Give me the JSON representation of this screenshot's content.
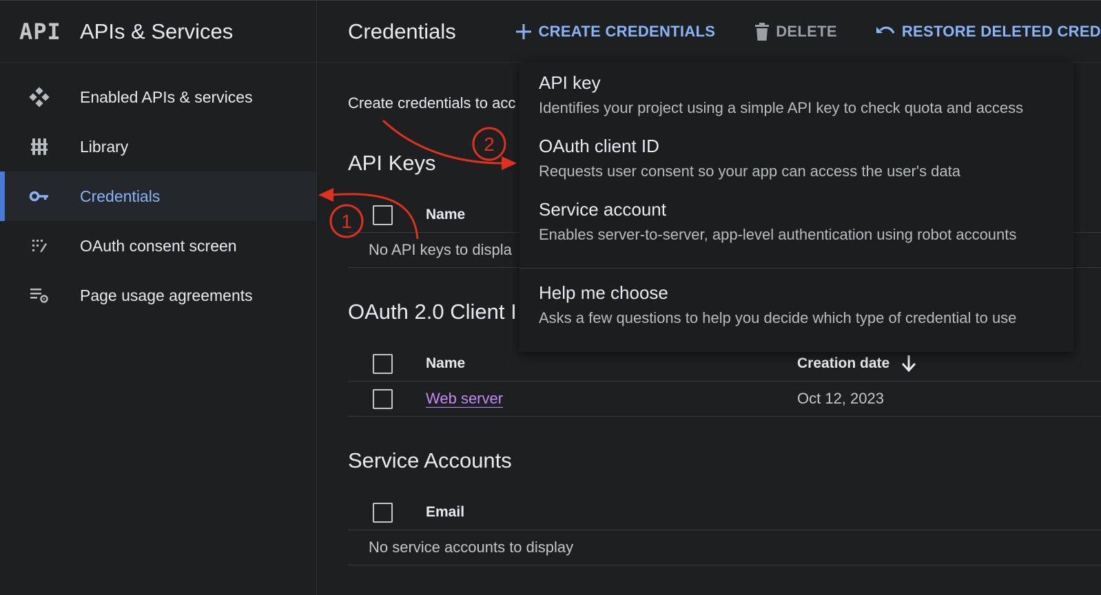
{
  "sidebar": {
    "logo": "API",
    "title": "APIs & Services",
    "items": [
      {
        "label": "Enabled APIs & services",
        "icon": "diamond-grid-icon"
      },
      {
        "label": "Library",
        "icon": "library-icon"
      },
      {
        "label": "Credentials",
        "icon": "key-icon",
        "active": true
      },
      {
        "label": "OAuth consent screen",
        "icon": "consent-screen-icon"
      },
      {
        "label": "Page usage agreements",
        "icon": "settings-list-icon"
      }
    ]
  },
  "toolbar": {
    "title": "Credentials",
    "create_label": "CREATE CREDENTIALS",
    "delete_label": "DELETE",
    "restore_label": "RESTORE DELETED CRED"
  },
  "main": {
    "intro": "Create credentials to acc",
    "api_keys": {
      "title": "API Keys",
      "columns": [
        "Name"
      ],
      "empty": "No API keys to displa"
    },
    "oauth_clients": {
      "title": "OAuth 2.0 Client I",
      "columns": [
        "Name",
        "Creation date"
      ],
      "rows": [
        {
          "name": "Web server",
          "creation_date": "Oct 12, 2023"
        }
      ]
    },
    "service_accounts": {
      "title": "Service Accounts",
      "columns": [
        "Email"
      ],
      "empty": "No service accounts to display"
    }
  },
  "menu": {
    "items": [
      {
        "title": "API key",
        "desc": "Identifies your project using a simple API key to check quota and access"
      },
      {
        "title": "OAuth client ID",
        "desc": "Requests user consent so your app can access the user's data"
      },
      {
        "title": "Service account",
        "desc": "Enables server-to-server, app-level authentication using robot accounts"
      },
      {
        "title": "Help me choose",
        "desc": "Asks a few questions to help you decide which type of credential to use"
      }
    ]
  },
  "annotations": {
    "step1": "1",
    "step2": "2",
    "color": "#e0301e"
  },
  "colors": {
    "accent": "#8ab4f8",
    "link": "#c58af9",
    "active_bar": "#4b7bd8",
    "background": "#1e1f21"
  }
}
